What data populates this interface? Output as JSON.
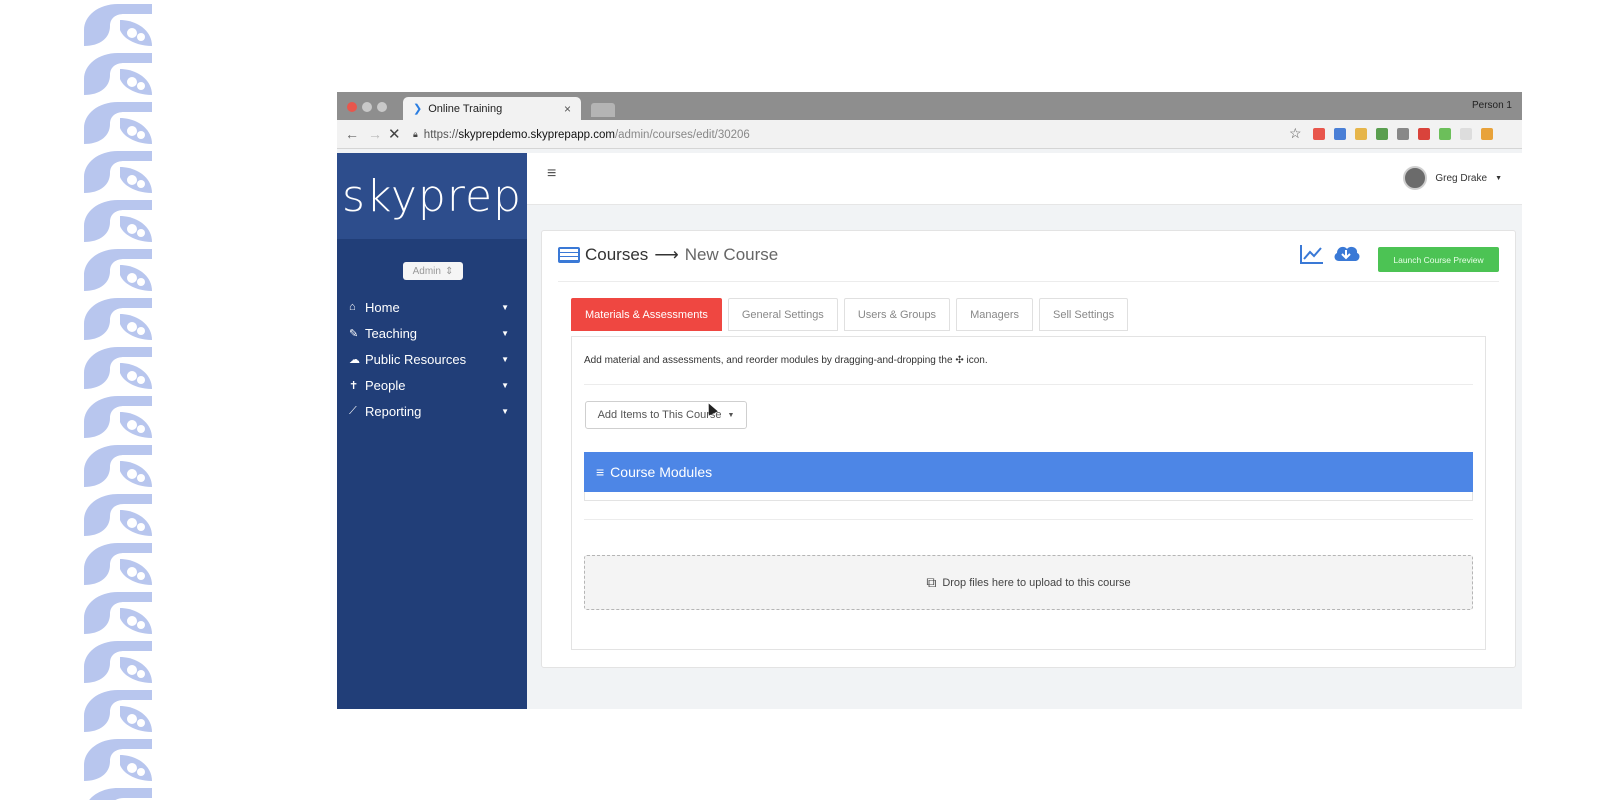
{
  "browser": {
    "tab_title": "Online Training",
    "tab_close": "×",
    "profile": "Person 1",
    "url": {
      "scheme": "https://",
      "host": "skyprepdemo.skyprepapp.com",
      "path": "/admin/courses/edit/30206"
    },
    "extension_colors": [
      "#e8564c",
      "#4a7fd6",
      "#e6b54a",
      "#5a9e4f",
      "#888888",
      "#d9433b",
      "#6cbf5a",
      "#dddddd",
      "#e8a23a"
    ]
  },
  "app": {
    "logo": "skyprep",
    "role_select": "Admin",
    "nav": [
      {
        "label": "Home",
        "icon": "home-icon",
        "glyph": "⌂"
      },
      {
        "label": "Teaching",
        "icon": "book-icon",
        "glyph": "✎"
      },
      {
        "label": "Public Resources",
        "icon": "cloud-icon",
        "glyph": "☁"
      },
      {
        "label": "People",
        "icon": "person-icon",
        "glyph": "✝"
      },
      {
        "label": "Reporting",
        "icon": "chart-icon",
        "glyph": "⟋"
      }
    ],
    "user_name": "Greg Drake",
    "breadcrumb": {
      "root": "Courses",
      "arrow": "⟶",
      "current": "New Course"
    },
    "launch_button": "Launch Course Preview",
    "tabs": [
      {
        "label": "Materials & Assessments",
        "active": true
      },
      {
        "label": "General Settings",
        "active": false
      },
      {
        "label": "Users & Groups",
        "active": false
      },
      {
        "label": "Managers",
        "active": false
      },
      {
        "label": "Sell Settings",
        "active": false
      }
    ],
    "help_text": "Add material and assessments, and reorder modules by dragging-and-dropping the ✣ icon.",
    "add_items_button": "Add Items to This Course",
    "modules_header": "Course Modules",
    "dropzone_text": "Drop files here to upload to this course"
  },
  "colors": {
    "sidebar": "#213e78",
    "active_tab": "#ef4741",
    "launch_green": "#4cc354",
    "modules_blue": "#4d86e6",
    "pattern": "#b8c6ee"
  }
}
